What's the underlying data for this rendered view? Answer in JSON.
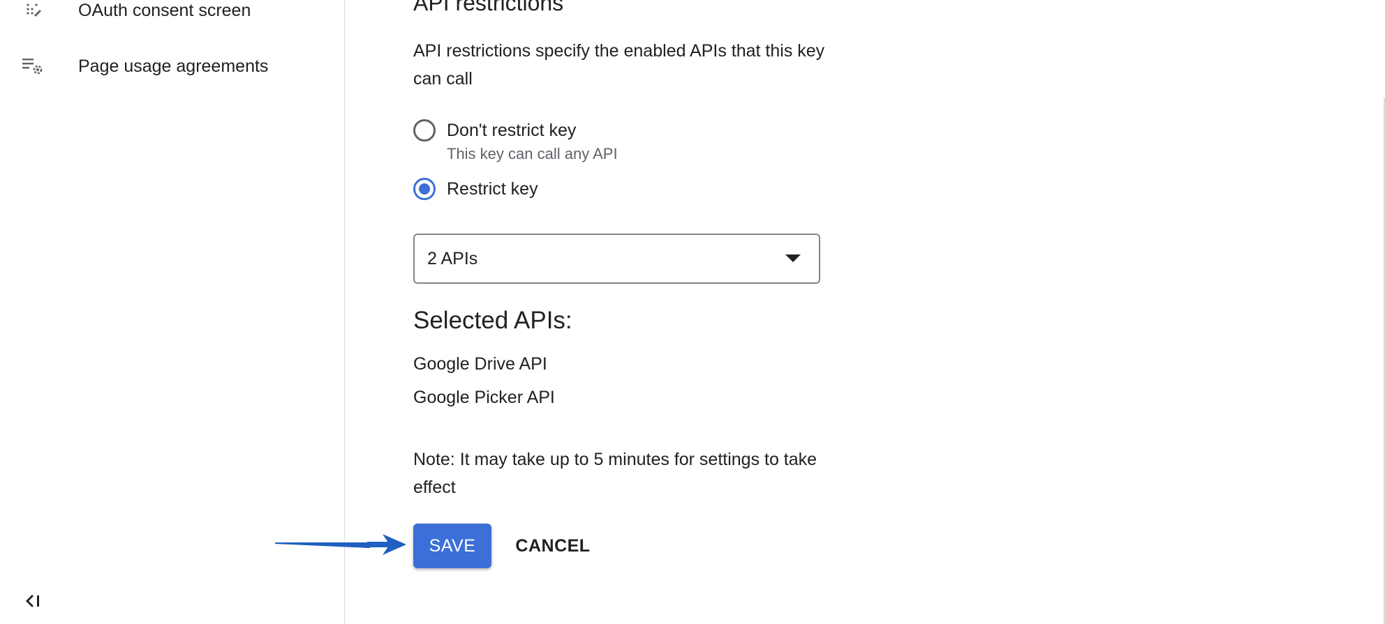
{
  "sidebar": {
    "items": [
      {
        "label": "OAuth consent screen",
        "icon": "oauth-consent-icon"
      },
      {
        "label": "Page usage agreements",
        "icon": "page-usage-settings-icon"
      }
    ],
    "collapse_icon": "collapse-sidebar-icon"
  },
  "api_restrictions": {
    "title": "API restrictions",
    "description": "API restrictions specify the enabled APIs that this key can call",
    "options": [
      {
        "label": "Don't restrict key",
        "help": "This key can call any API",
        "selected": false
      },
      {
        "label": "Restrict key",
        "selected": true
      }
    ],
    "select": {
      "value": "2 APIs"
    },
    "selected_heading": "Selected APIs:",
    "selected_apis": [
      "Google Drive API",
      "Google Picker API"
    ],
    "note": "Note: It may take up to 5 minutes for settings to take effect"
  },
  "actions": {
    "save_label": "SAVE",
    "cancel_label": "CANCEL"
  },
  "colors": {
    "accent": "#3c6fd8",
    "annotation_arrow": "#1f5fbf"
  }
}
